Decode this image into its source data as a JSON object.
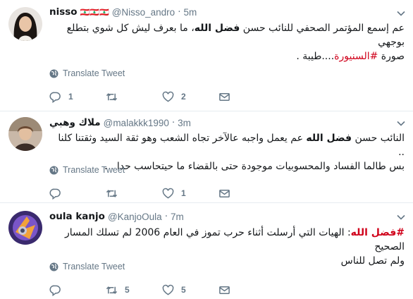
{
  "translate_label": "Translate Tweet",
  "tweets": [
    {
      "name": "nisso",
      "flags": "🇱🇧🇱🇧🇱🇧",
      "handle": "@Nisso_andro",
      "dot": "·",
      "time": "5m",
      "text_l1_a": "عم إسمع المؤتمر الصحفي للنائب حسن ",
      "text_l1_b": "فضل الله",
      "text_l1_c": "، ما بعرف ليش كل شوي بتطلع",
      "text_l2": "بوجهي",
      "text_l3_a": "صورة ",
      "text_l3_b": "#السنيورة",
      "text_l3_c": "....طيبة .",
      "replies": "1",
      "retweets": "",
      "likes": "2"
    },
    {
      "name": "ملاك وهبي",
      "handle": "@malakkk1990",
      "dot": "·",
      "time": "3m",
      "text_l1_a": "النائب حسن ",
      "text_l1_b": "فضل الله",
      "text_l1_c": " عم يعمل واجبه عالآخر تجاه الشعب وهو ثقة السيد وثقتنا كلنا ..",
      "text_l2": "بس طالما الفساد والمحسوبيات موجودة حتى بالقضاء ما حيتحاسب حدا . .",
      "replies": "",
      "retweets": "",
      "likes": "1"
    },
    {
      "name": "oula kanjo",
      "handle": "@KanjoOula",
      "dot": "·",
      "time": "7m",
      "text_l1_a": "#فضل الله",
      "text_l1_b": ": الهيات التي أرسلت أثناء حرب تموز في العام 2006 لم تسلك المسار الصحيح",
      "text_l2": "ولم تصل للناس",
      "replies": "",
      "retweets": "5",
      "likes": "5"
    }
  ],
  "colors": {
    "hashtag": "#d0021b",
    "muted": "#657786",
    "divider": "#e6ecf0"
  }
}
